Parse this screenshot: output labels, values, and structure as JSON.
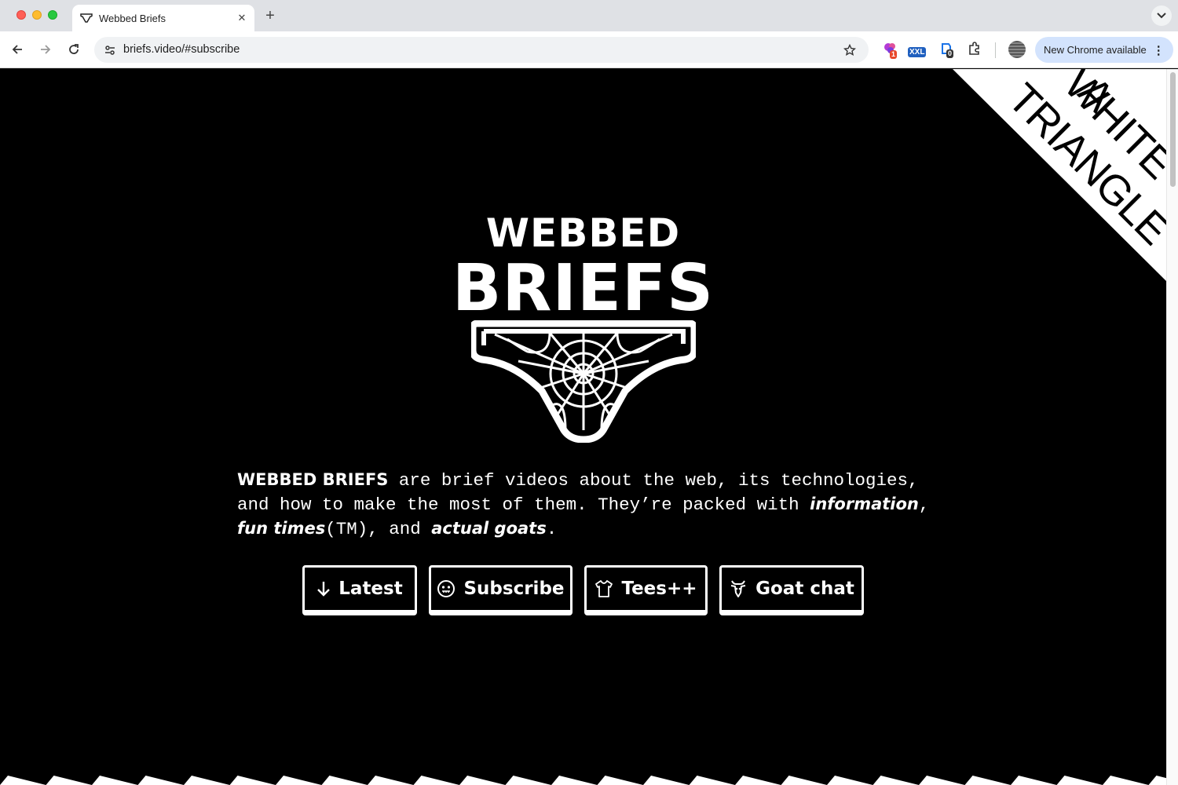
{
  "browser": {
    "tab_title": "Webbed Briefs",
    "url": "briefs.video/#subscribe",
    "update_label": "New Chrome available",
    "extensions": [
      {
        "name": "extension-1",
        "badge": "1"
      },
      {
        "name": "xxl-extension",
        "badge": "XXL"
      },
      {
        "name": "extension-3",
        "badge": "0"
      }
    ]
  },
  "corner": {
    "line1": "A",
    "line2": "WHITE",
    "line3": "TRIANGLE"
  },
  "logo": {
    "word1": "WEBBED",
    "word2": "BRIEFS"
  },
  "intro": {
    "brand": "WEBBED BRIEFS",
    "text1": " are brief videos about the web, its technologies, and how to make the most of them. They’re packed with ",
    "em1": "information",
    "sep1": ", ",
    "em2": "fun times",
    "tm": "(TM), and ",
    "em3": "actual goats",
    "end": "."
  },
  "buttons": {
    "latest": "Latest",
    "subscribe": "Subscribe",
    "tees": "Tees++",
    "goat_chat": "Goat chat"
  },
  "icons": {
    "latest": "arrow-down-icon",
    "subscribe": "face-icon",
    "tees": "tshirt-icon",
    "goat_chat": "goat-icon"
  },
  "colors": {
    "page_bg": "#000000",
    "foreground": "#ffffff",
    "update_pill": "#d3e3fd"
  }
}
